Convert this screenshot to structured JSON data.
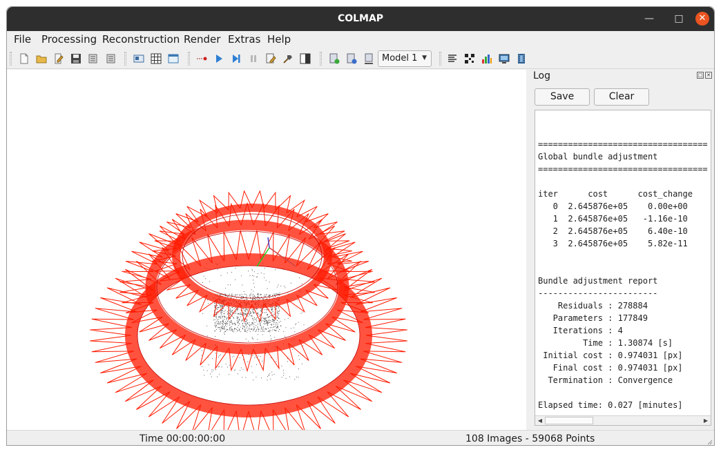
{
  "window": {
    "title": "COLMAP"
  },
  "menu": {
    "items": [
      "File",
      "Processing",
      "Reconstruction",
      "Render",
      "Extras",
      "Help"
    ]
  },
  "toolbar": {
    "icons": [
      "new-project-icon",
      "open-project-icon",
      "edit-project-icon",
      "save-project-icon",
      "import-model-icon",
      "export-model-icon",
      "feature-extraction-icon",
      "feature-matching-icon",
      "database-management-icon",
      "automatic-reconstruction-icon",
      "start-reconstruction-icon",
      "step-reconstruction-icon",
      "pause-reconstruction-icon",
      "reconstruction-options-icon",
      "bundle-adjustment-icon",
      "render-options-icon",
      "add-model-icon",
      "remove-model-icon",
      "reset-model-icon",
      "reconstruction-stats-icon",
      "match-matrix-icon",
      "grab-image-icon",
      "grab-movie-icon"
    ],
    "model_select": "Model 1"
  },
  "log": {
    "title": "Log",
    "save_label": "Save",
    "clear_label": "Clear",
    "text": "\n==================================\nGlobal bundle adjustment\n==================================\n\niter      cost      cost_change\n   0  2.645876e+05    0.00e+00\n   1  2.645876e+05   -1.16e-10\n   2  2.645876e+05    6.40e-10\n   3  2.645876e+05    5.82e-11\n\n\nBundle adjustment report\n------------------------\n    Residuals : 278884\n   Parameters : 177849\n   Iterations : 4\n         Time : 1.30874 [s]\n Initial cost : 0.974031 [px]\n   Final cost : 0.974031 [px]\n  Termination : Convergence\n\nElapsed time: 0.027 [minutes]"
  },
  "status": {
    "time": "Time 00:00:00:00",
    "counts": "108 Images - 59068 Points"
  },
  "colors": {
    "camera_frustum": "#ff1a00",
    "titlebar": "#2e2e2e",
    "close_button": "#e95420"
  }
}
